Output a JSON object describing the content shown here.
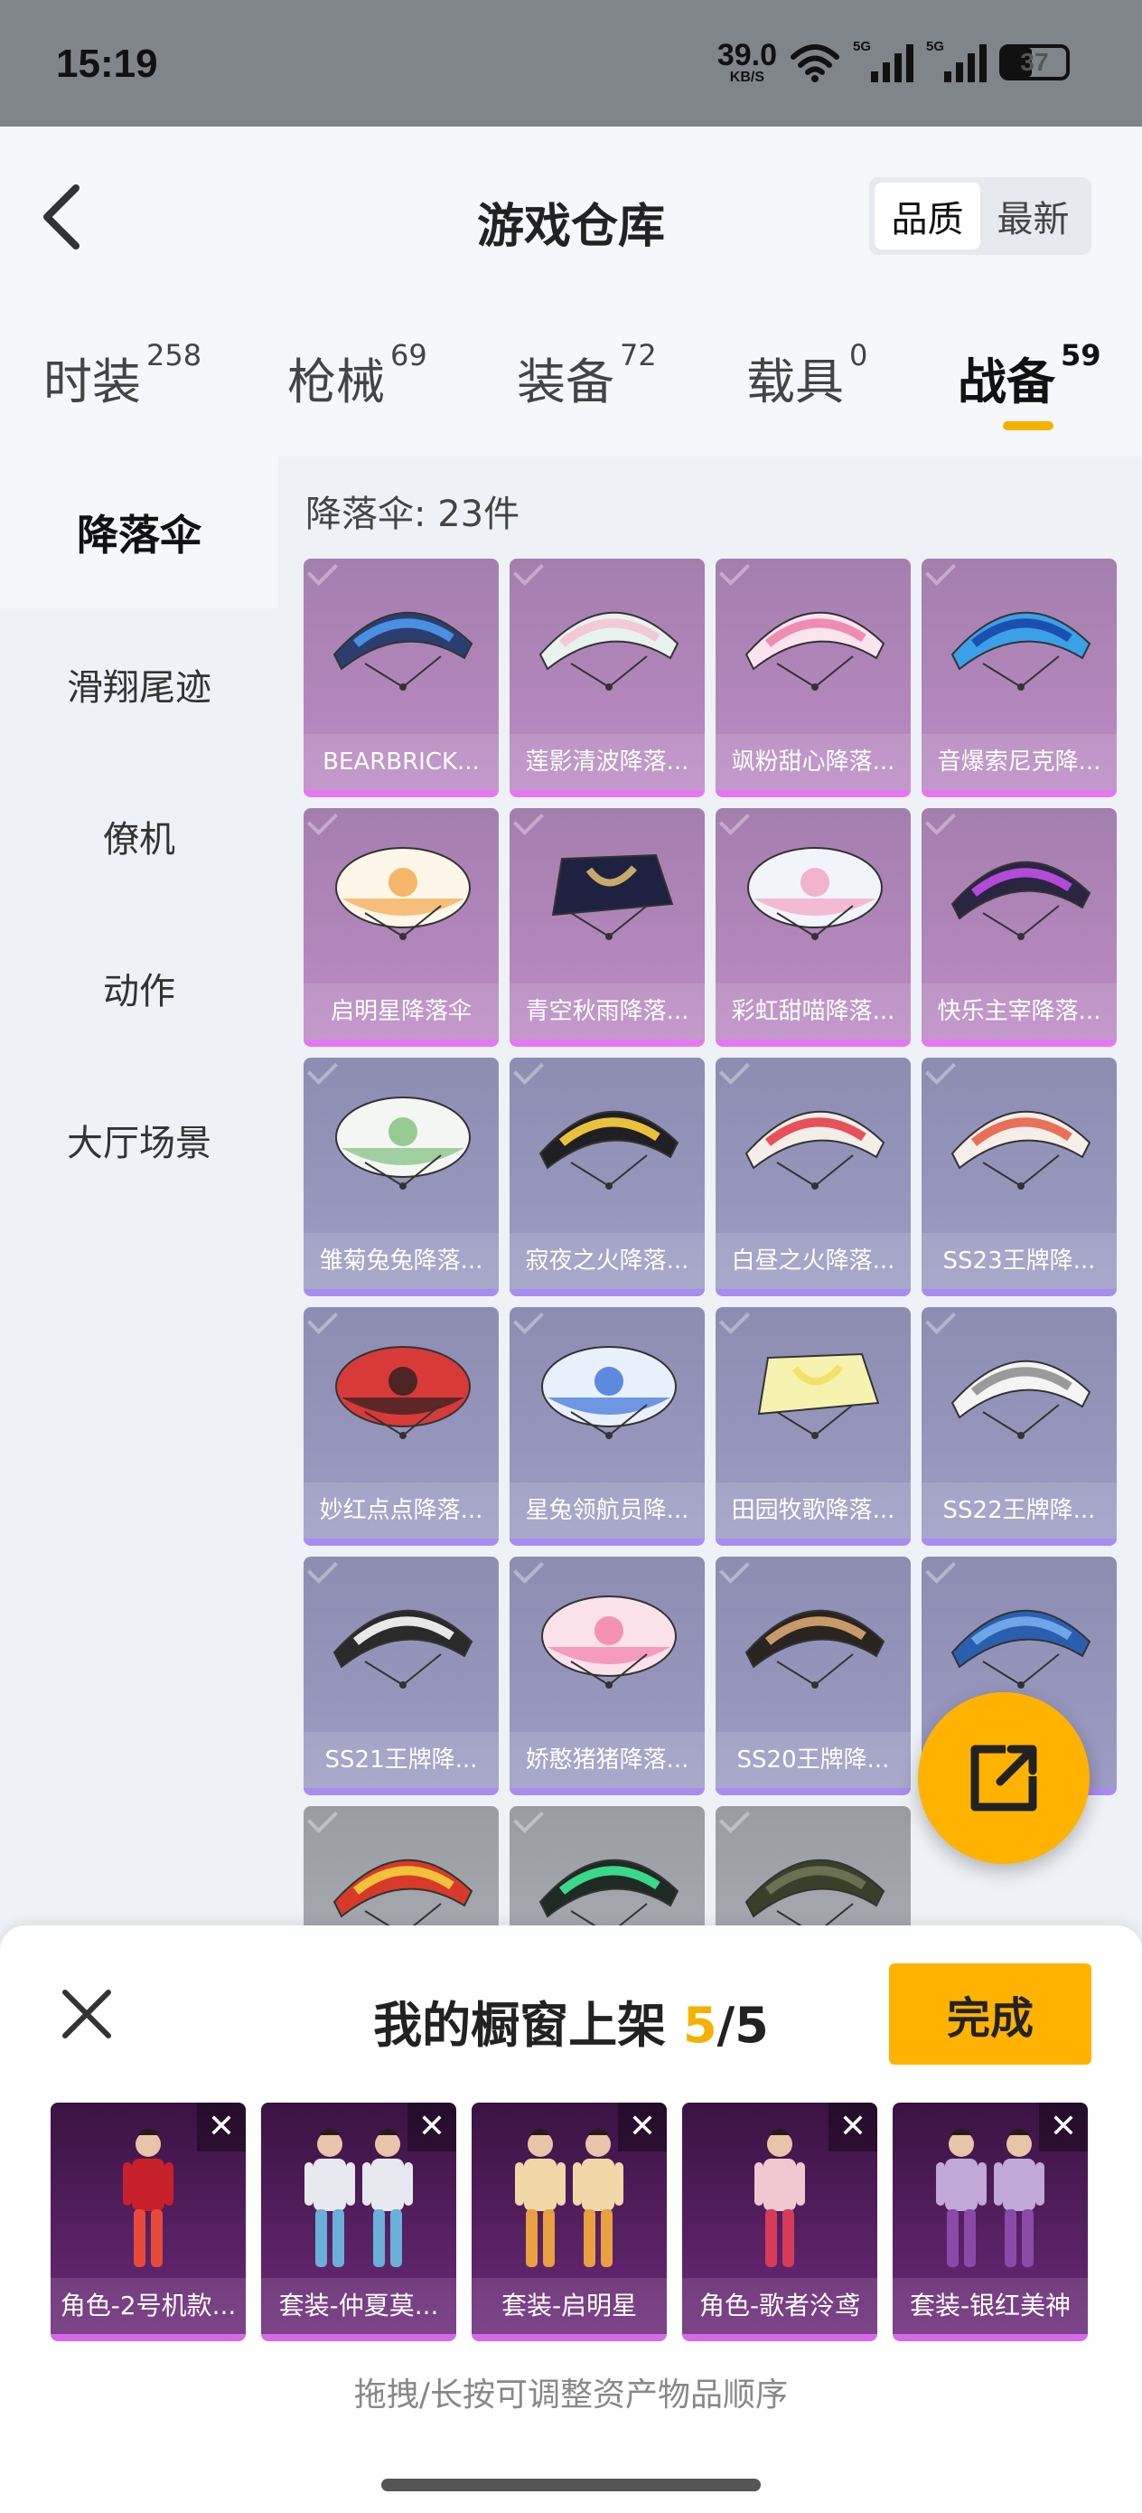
{
  "status": {
    "time": "15:19",
    "speed": "39.0",
    "speed_unit": "KB/S",
    "sim1": "5G",
    "sim2": "5G",
    "battery": "37"
  },
  "header": {
    "title": "游戏仓库",
    "sort_options": [
      "品质",
      "最新"
    ],
    "active_sort": "品质"
  },
  "tabs": [
    {
      "label": "时装",
      "count": "258"
    },
    {
      "label": "枪械",
      "count": "69"
    },
    {
      "label": "装备",
      "count": "72"
    },
    {
      "label": "载具",
      "count": "0"
    },
    {
      "label": "战备",
      "count": "59"
    }
  ],
  "active_tab": "战备",
  "sidebar": {
    "items": [
      "降落伞",
      "滑翔尾迹",
      "僚机",
      "动作",
      "大厅场景"
    ],
    "active": "降落伞"
  },
  "list": {
    "count_label": "降落伞: 23件",
    "items": [
      {
        "name": "BEARBRICK...",
        "rarity": "pink",
        "colors": [
          "#2c3e70",
          "#4a90e2"
        ],
        "shape": "wing"
      },
      {
        "name": "莲影清波降落...",
        "rarity": "pink",
        "colors": [
          "#e8f3f0",
          "#f3c9d8"
        ],
        "shape": "wing"
      },
      {
        "name": "飒粉甜心降落...",
        "rarity": "pink",
        "colors": [
          "#fce4ee",
          "#f08cb4"
        ],
        "shape": "wing"
      },
      {
        "name": "音爆索尼克降...",
        "rarity": "pink",
        "colors": [
          "#3aa0e8",
          "#1b4fb0"
        ],
        "shape": "wing"
      },
      {
        "name": "启明星降落伞",
        "rarity": "pink",
        "colors": [
          "#fff6ea",
          "#f2a64a"
        ],
        "shape": "dome"
      },
      {
        "name": "青空秋雨降落...",
        "rarity": "pink",
        "colors": [
          "#1e2240",
          "#c9a86b"
        ],
        "shape": "square"
      },
      {
        "name": "彩虹甜喵降落...",
        "rarity": "pink",
        "colors": [
          "#f1f5fb",
          "#f3a2c0"
        ],
        "shape": "dome"
      },
      {
        "name": "快乐主宰降落...",
        "rarity": "pink",
        "colors": [
          "#2a2540",
          "#b24bd8"
        ],
        "shape": "wing"
      },
      {
        "name": "雏菊兔兔降落...",
        "rarity": "blue",
        "colors": [
          "#f4f6f4",
          "#7fbf7a"
        ],
        "shape": "dome"
      },
      {
        "name": "寂夜之火降落...",
        "rarity": "blue",
        "colors": [
          "#1f1f24",
          "#e8c23a"
        ],
        "shape": "wing"
      },
      {
        "name": "白昼之火降落...",
        "rarity": "blue",
        "colors": [
          "#f3efe8",
          "#e8505a"
        ],
        "shape": "wing"
      },
      {
        "name": "SS23王牌降...",
        "rarity": "blue",
        "colors": [
          "#f6eee8",
          "#e8705a"
        ],
        "shape": "wing"
      },
      {
        "name": "妙红点点降落...",
        "rarity": "blue",
        "colors": [
          "#d83a3a",
          "#2a1f1f"
        ],
        "shape": "dome"
      },
      {
        "name": "星兔领航员降...",
        "rarity": "blue",
        "colors": [
          "#e8f1fb",
          "#3a6fd8"
        ],
        "shape": "dome"
      },
      {
        "name": "田园牧歌降落...",
        "rarity": "blue",
        "colors": [
          "#f6f2b0",
          "#f2e26a"
        ],
        "shape": "square"
      },
      {
        "name": "SS22王牌降...",
        "rarity": "blue",
        "colors": [
          "#f4f4f4",
          "#9a9a9a"
        ],
        "shape": "wing"
      },
      {
        "name": "SS21王牌降...",
        "rarity": "blue",
        "colors": [
          "#2a2a2a",
          "#e8e8e8"
        ],
        "shape": "wing"
      },
      {
        "name": "娇憨猪猪降落...",
        "rarity": "blue",
        "colors": [
          "#fbe2ea",
          "#f27ea6"
        ],
        "shape": "dome"
      },
      {
        "name": "SS20王牌降...",
        "rarity": "blue",
        "colors": [
          "#2a2420",
          "#c89a6a"
        ],
        "shape": "wing"
      },
      {
        "name": "",
        "rarity": "blue",
        "colors": [
          "#2a5fb0",
          "#6fa6e8"
        ],
        "shape": "wing"
      },
      {
        "name": "",
        "rarity": "grey",
        "colors": [
          "#d83a2a",
          "#f2c23a"
        ],
        "shape": "wing"
      },
      {
        "name": "",
        "rarity": "grey",
        "colors": [
          "#1f2a24",
          "#3ad88a"
        ],
        "shape": "wing"
      },
      {
        "name": "",
        "rarity": "grey",
        "colors": [
          "#3a3f2a",
          "#6a7050"
        ],
        "shape": "wing"
      }
    ]
  },
  "showcase": {
    "title_prefix": "我的橱窗上架",
    "current": "5",
    "max": "/5",
    "done_label": "完成",
    "items": [
      {
        "name": "角色-2号机款...",
        "colors": [
          "#c8202a",
          "#e84a3a"
        ]
      },
      {
        "name": "套装-仲夏莫...",
        "colors": [
          "#e8e8f0",
          "#6ab0d8"
        ]
      },
      {
        "name": "套装-启明星",
        "colors": [
          "#f2d8a8",
          "#e8a040"
        ]
      },
      {
        "name": "角色-歌者泠鸢",
        "colors": [
          "#f2c8d0",
          "#d83a5a"
        ]
      },
      {
        "name": "套装-银红美神",
        "colors": [
          "#c0a8d8",
          "#8a4aa8"
        ]
      }
    ],
    "hint": "拖拽/长按可调整资产物品顺序"
  }
}
